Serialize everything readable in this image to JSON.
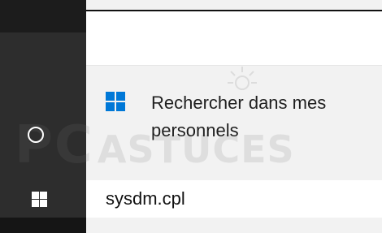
{
  "search_panel": {
    "result": {
      "icon": "windows-logo-icon",
      "line1": "Rechercher dans mes",
      "line2": "personnels"
    },
    "query": "sysdm.cpl"
  },
  "taskbar": {
    "cortana_icon": "cortana-circle-icon",
    "start_icon": "windows-start-icon"
  },
  "watermark": {
    "part1": "PC",
    "part2": "ASTUCES"
  },
  "colors": {
    "taskbar": "#2d2d2d",
    "windows_blue": "#0078d7"
  }
}
